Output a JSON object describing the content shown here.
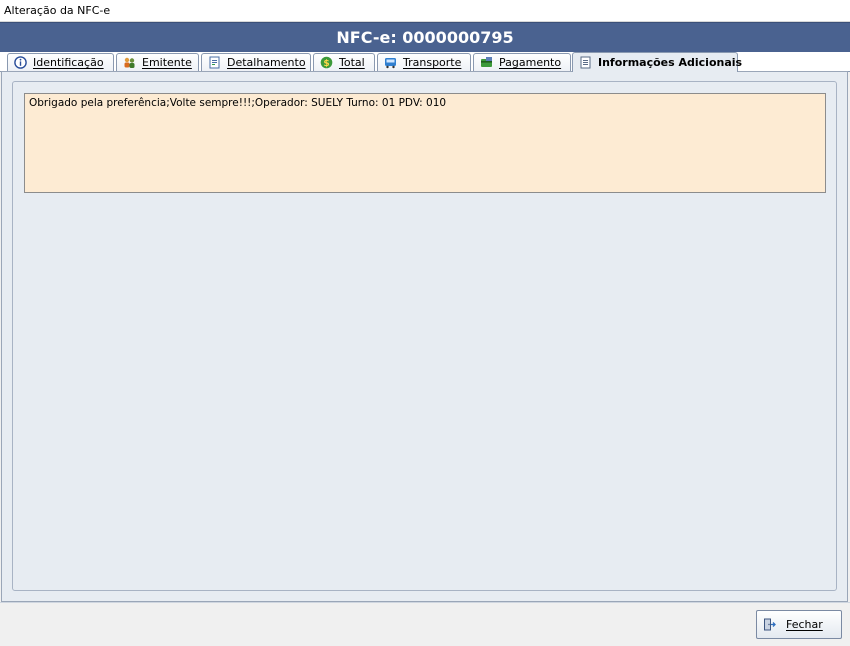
{
  "window": {
    "title": "Alteração da NFC-e"
  },
  "header": {
    "title": "NFC-e: 0000000795"
  },
  "tabs": [
    {
      "label": "Identificação",
      "icon": "info-icon"
    },
    {
      "label": "Emitente",
      "icon": "people-icon"
    },
    {
      "label": "Detalhamento",
      "icon": "document-icon"
    },
    {
      "label": "Total",
      "icon": "dollar-icon"
    },
    {
      "label": "Transporte",
      "icon": "bus-icon"
    },
    {
      "label": "Pagamento",
      "icon": "payment-icon"
    },
    {
      "label": "Informações Adicionais",
      "icon": "notes-icon",
      "active": true
    }
  ],
  "additional_info": {
    "text": "Obrigado pela preferência;Volte sempre!!!;Operador: SUELY Turno: 01 PDV: 010"
  },
  "footer": {
    "close_label": "Fechar",
    "close_icon": "exit-door-icon"
  },
  "colors": {
    "header_bg": "#4a6290",
    "panel_bg": "#e7ecf2",
    "memo_bg": "#fdebd3"
  }
}
